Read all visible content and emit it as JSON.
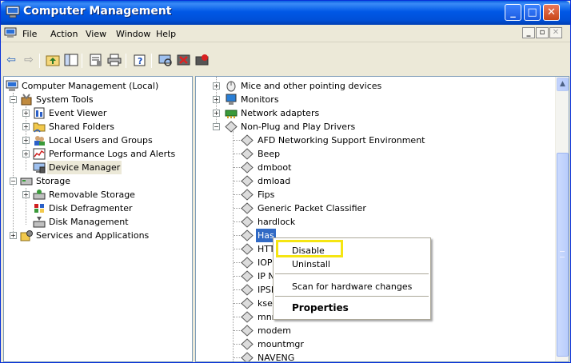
{
  "window": {
    "title": "Computer Management",
    "controls": {
      "minimize": "_",
      "maximize": "□",
      "close": "✕"
    }
  },
  "menubar": {
    "items": [
      "File",
      "Action",
      "View",
      "Window",
      "Help"
    ],
    "mdi": {
      "minimize": "_",
      "restore": "▫",
      "close": "✕"
    }
  },
  "toolbar": {
    "icons": [
      "back-icon",
      "forward-icon",
      "up-folder-icon",
      "show-hide-tree-icon",
      "properties-icon",
      "print-icon",
      "help-icon",
      "scan-hardware-icon",
      "uninstall-icon",
      "disable-icon"
    ]
  },
  "left_tree": [
    {
      "label": "Computer Management (Local)",
      "level": 0,
      "expander": "",
      "icon": "computer-management-icon"
    },
    {
      "label": "System Tools",
      "level": 1,
      "expander": "−",
      "icon": "system-tools-icon"
    },
    {
      "label": "Event Viewer",
      "level": 2,
      "expander": "+",
      "icon": "event-viewer-icon"
    },
    {
      "label": "Shared Folders",
      "level": 2,
      "expander": "+",
      "icon": "shared-folders-icon"
    },
    {
      "label": "Local Users and Groups",
      "level": 2,
      "expander": "+",
      "icon": "users-groups-icon"
    },
    {
      "label": "Performance Logs and Alerts",
      "level": 2,
      "expander": "+",
      "icon": "performance-logs-icon"
    },
    {
      "label": "Device Manager",
      "level": 2,
      "expander": "",
      "icon": "device-manager-icon",
      "selected": true
    },
    {
      "label": "Storage",
      "level": 1,
      "expander": "−",
      "icon": "storage-icon"
    },
    {
      "label": "Removable Storage",
      "level": 2,
      "expander": "+",
      "icon": "removable-storage-icon"
    },
    {
      "label": "Disk Defragmenter",
      "level": 2,
      "expander": "",
      "icon": "disk-defragmenter-icon"
    },
    {
      "label": "Disk Management",
      "level": 2,
      "expander": "",
      "icon": "disk-management-icon"
    },
    {
      "label": "Services and Applications",
      "level": 1,
      "expander": "+",
      "icon": "services-applications-icon"
    }
  ],
  "right_tree": {
    "categories": [
      {
        "label": "Mice and other pointing devices",
        "expander": "+",
        "icon": "mouse-icon"
      },
      {
        "label": "Monitors",
        "expander": "+",
        "icon": "monitor-icon"
      },
      {
        "label": "Network adapters",
        "expander": "+",
        "icon": "network-adapter-icon"
      },
      {
        "label": "Non-Plug and Play Drivers",
        "expander": "−",
        "icon": "driver-icon"
      }
    ],
    "drivers": [
      "AFD Networking Support Environment",
      "Beep",
      "dmboot",
      "dmload",
      "Fips",
      "Generic Packet Classifier",
      "hardlock",
      "Has",
      "HTT",
      "IOP",
      "IP N",
      "IPSI",
      "ksec",
      "mnmdd",
      "modem",
      "mountmgr",
      "NAVENG"
    ],
    "selected_index": 7
  },
  "context_menu": {
    "items": [
      {
        "label": "Disable",
        "bold": false
      },
      {
        "label": "Uninstall",
        "bold": false
      },
      {
        "label": "Scan for hardware changes",
        "bold": false
      },
      {
        "label": "Properties",
        "bold": true
      }
    ],
    "highlighted": "Disable",
    "highlight_color": "#f5e512"
  },
  "colors": {
    "titlebar": "#0058e6",
    "selection": "#316ac5",
    "window_bg": "#ece9d8"
  }
}
